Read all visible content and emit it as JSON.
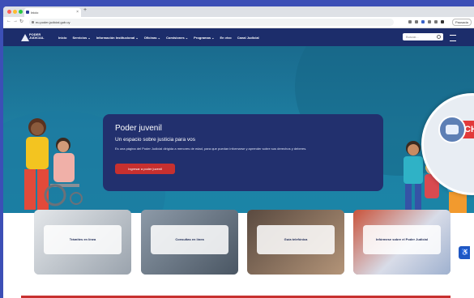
{
  "browser": {
    "tab_title": "Inicio",
    "url": "eu.poder-judicial.gub.uy",
    "new_tab": "+",
    "profile_label": "Pausada"
  },
  "site": {
    "logo_line1": "PODER JUDICIAL",
    "logo_line2": "",
    "menu": [
      "Inicio",
      "Servicios ⌄",
      "Información Institucional ⌄",
      "Oficinas ⌄",
      "Comisiones ⌄",
      "Programas ⌄",
      "En vivo",
      "Canal Judicial"
    ],
    "search_placeholder": "Buscar..."
  },
  "hero": {
    "title": "Poder juvenil",
    "subtitle": "Un espacio sobre justicia para vos",
    "description": "Es una página del Poder Judicial dirigida a menores de edad, para que puedan informarse y aprender sobre sus derechos y deberes.",
    "cta": "Ingresar a poder juvenil"
  },
  "chat": {
    "label": "CHA"
  },
  "cards": [
    {
      "label": "Trámites en línea"
    },
    {
      "label": "Consultas en línea"
    },
    {
      "label": "Guía telefónica"
    },
    {
      "label": "Infórmese sobre el Poder Judicial"
    }
  ],
  "colors": {
    "nav": "#1c2d6b",
    "hero": "#1a6b8e",
    "banner": "#22306e",
    "accent": "#c7302f"
  }
}
